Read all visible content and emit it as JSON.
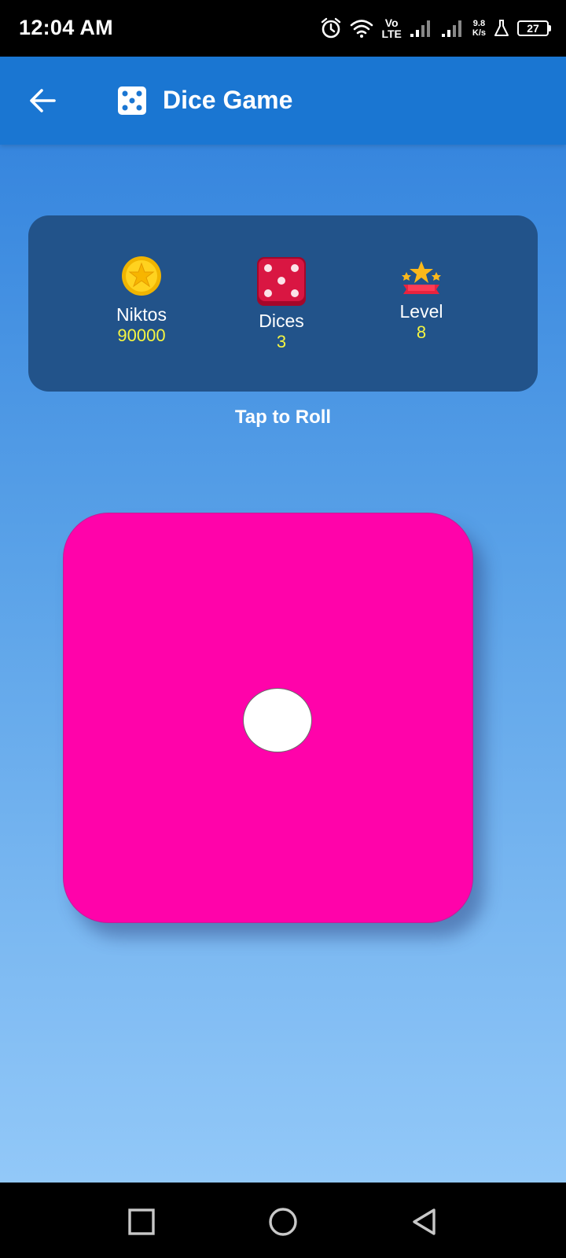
{
  "status_bar": {
    "time": "12:04 AM",
    "network_type_top": "Vo",
    "network_type_bottom": "LTE",
    "net_speed_value": "9.8",
    "net_speed_unit": "K/s",
    "battery_level": "27"
  },
  "app_bar": {
    "title": "Dice Game",
    "back_icon": "arrow-left-icon",
    "title_icon": "dice-icon"
  },
  "stats": {
    "coins": {
      "label": "Niktos",
      "value": "90000",
      "icon": "coin-star-icon"
    },
    "dices": {
      "label": "Dices",
      "value": "3",
      "icon": "red-dice-icon"
    },
    "level": {
      "label": "Level",
      "value": "8",
      "icon": "stars-ribbon-icon"
    }
  },
  "prompt": "Tap to Roll",
  "dice": {
    "face_value": 1,
    "color": "#ff03aa"
  },
  "colors": {
    "app_bar": "#1a76d2",
    "stats_card": "#22538a",
    "stat_value": "#f5f542"
  },
  "nav_bar": {
    "recents_icon": "square-icon",
    "home_icon": "circle-icon",
    "back_icon": "triangle-back-icon"
  }
}
